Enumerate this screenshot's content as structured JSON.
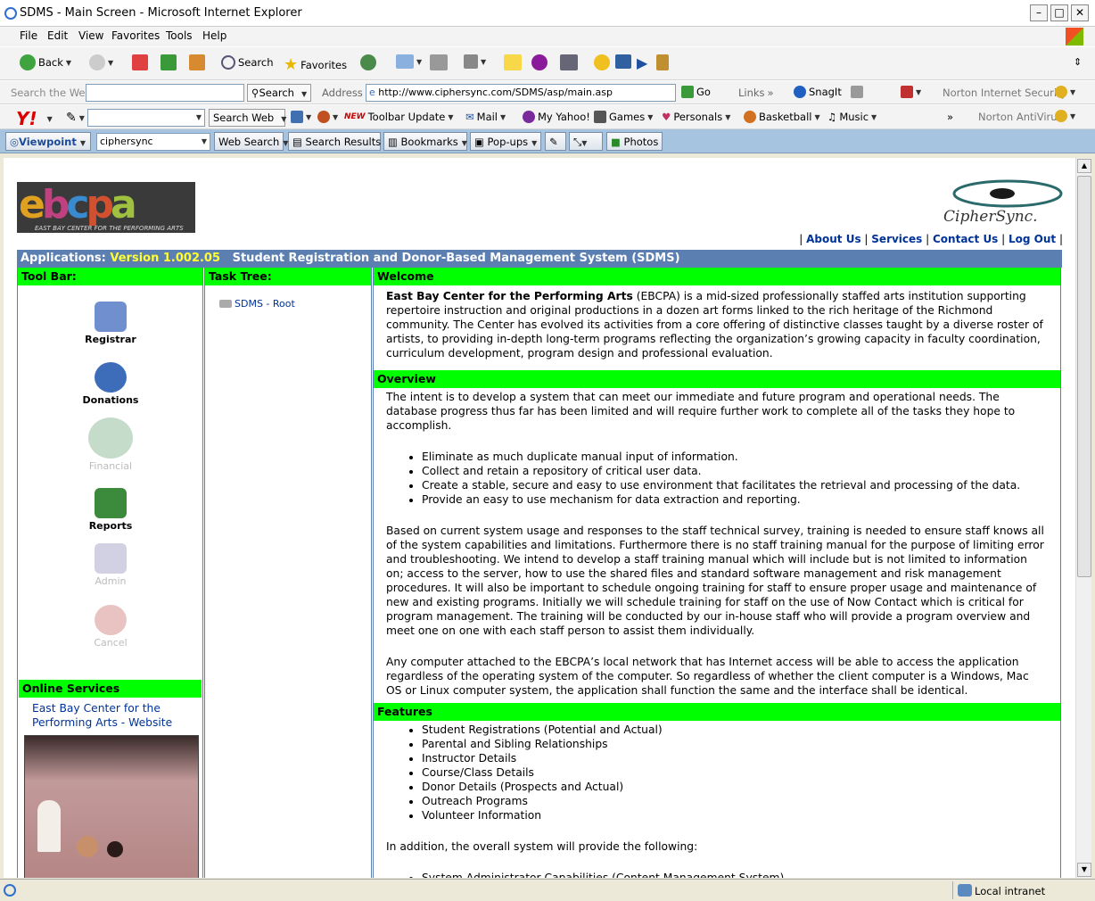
{
  "window": {
    "title": "SDMS - Main Screen - Microsoft Internet Explorer"
  },
  "menu": [
    "File",
    "Edit",
    "View",
    "Favorites",
    "Tools",
    "Help"
  ],
  "toolbar": {
    "back": "Back",
    "search": "Search",
    "favorites": "Favorites"
  },
  "addressbar": {
    "search_placeholder": "Search the Web",
    "search_btn": "Search",
    "address_label": "Address",
    "url": "http://www.ciphersync.com/SDMS/asp/main.asp",
    "go": "Go",
    "links": "Links",
    "snagit": "SnagIt",
    "norton": "Norton Internet Security"
  },
  "yahoobar": {
    "search_web": "Search Web",
    "toolbar_update": "Toolbar Update",
    "new_badge": "NEW",
    "mail": "Mail",
    "myyahoo": "My Yahoo!",
    "games": "Games",
    "personals": "Personals",
    "basketball": "Basketball",
    "music": "Music",
    "more": "»",
    "antivirus": "Norton AntiVirus"
  },
  "viewpointbar": {
    "viewpoint": "Viewpoint",
    "query": "ciphersync",
    "websearch": "Web Search",
    "results": "Search Results",
    "bookmarks": "Bookmarks",
    "popups": "Pop-ups",
    "photos": "Photos"
  },
  "page": {
    "logo_text": "ebcpa",
    "logo_sub": "EAST BAY CENTER FOR THE PERFORMING ARTS",
    "cipher_logo": "CipherSync.",
    "toplinks": [
      "About Us",
      "Services",
      "Contact Us",
      "Log Out"
    ],
    "app_label": "Applications:",
    "version": "Version 1.002.05",
    "app_title": "Student Registration and Donor-Based Management System (SDMS)",
    "toolbar_head": "Tool Bar:",
    "tools": [
      {
        "label": "Registrar",
        "enabled": true,
        "color": "#6f8fcf"
      },
      {
        "label": "Donations",
        "enabled": true,
        "color": "#3d6cb8"
      },
      {
        "label": "Financial",
        "enabled": false,
        "color": "#5a9a6a"
      },
      {
        "label": "Reports",
        "enabled": true,
        "color": "#3c8a3c"
      },
      {
        "label": "Admin",
        "enabled": false,
        "color": "#7a7ab0"
      },
      {
        "label": "Cancel",
        "enabled": false,
        "color": "#c05050"
      }
    ],
    "online_head": "Online Services",
    "online_link": "East Bay Center for the Performing Arts - Website",
    "task_head": "Task Tree:",
    "task_root": "SDMS - Root",
    "welcome_head": "Welcome",
    "welcome_org": "East Bay Center for the Performing Arts",
    "welcome_text": " (EBCPA) is a mid-sized professionally staffed arts institution supporting repertoire instruction and original productions in a dozen art forms linked to the rich heritage of the Richmond community.  The Center has evolved its activities from a core offering of distinctive classes taught by a diverse roster of artists, to providing in-depth long-term programs reflecting the organization’s growing capacity in faculty coordination, curriculum development, program design and professional evaluation.",
    "overview_head": "Overview",
    "overview_p1": "The intent is to develop a system that can meet our immediate and future program and operational needs.  The database progress thus far has been limited and will require further work to complete all of the tasks they hope to accomplish.",
    "overview_list": [
      "Eliminate as much duplicate manual input of information.",
      "Collect and retain a repository of critical user data.",
      "Create a stable, secure and easy to use environment that facilitates the retrieval and processing of the data.",
      "Provide an easy to use mechanism for data extraction and reporting."
    ],
    "overview_p2": "Based on current system usage and responses to the staff technical survey, training is needed to ensure staff knows all of the system capabilities and limitations.  Furthermore there is no staff training manual for the purpose of limiting error and troubleshooting.  We intend to develop a staff training manual which will include but is not limited to information on;  access to the server, how to use the shared files and standard software management and risk management procedures. It will also be important to schedule ongoing training for staff to ensure proper usage and maintenance of new and existing programs.  Initially we will schedule training for staff on the use of Now Contact which is critical for program management.  The training will be conducted by our in-house staff who will provide a program overview and meet one on one with each staff person to assist them individually.",
    "overview_p3": "Any computer attached to the EBCPA’s local network that has Internet access will be able to access the application regardless of the operating system of the computer. So regardless of whether the client computer is a Windows, Mac OS or Linux computer system, the application shall function the same and the interface shall be identical.",
    "features_head": "Features",
    "features_list": [
      "Student Registrations (Potential and Actual)",
      "Parental and Sibling Relationships",
      "Instructor Details",
      "Course/Class Details",
      "Donor Details (Prospects and Actual)",
      "Outreach Programs",
      "Volunteer Information"
    ],
    "features_p": "In addition, the overall system will provide the following:",
    "features_list2": [
      "System Administrator Capabilities (Content Management System)"
    ]
  },
  "status": {
    "zone": "Local intranet"
  },
  "colors": {
    "section_green": "#00ff00",
    "app_bar": "#5a7fb0",
    "version": "#ffff33",
    "link": "#003399"
  }
}
